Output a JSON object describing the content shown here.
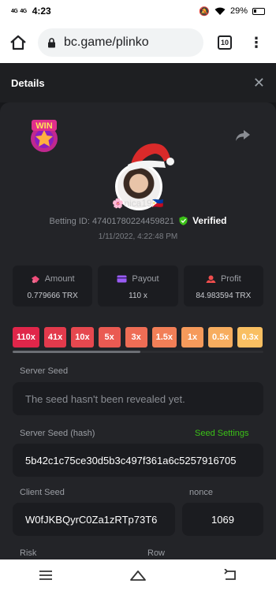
{
  "status": {
    "signal_1": "4G",
    "signal_2": "4G",
    "time": "4:23",
    "battery": "29%"
  },
  "browser": {
    "url": "bc.game/plinko",
    "tab_count": "10"
  },
  "modal": {
    "title": "Details"
  },
  "profile": {
    "badge_text": "WIN",
    "username": "🌸nica19🇵🇭",
    "betting_id_label": "Betting ID: 47401780224459821",
    "verified_label": "Verified",
    "date": "1/11/2022, 4:22:48 PM"
  },
  "stats": [
    {
      "label": "Amount",
      "value": "0.779666 TRX",
      "icon": "amount-icon"
    },
    {
      "label": "Payout",
      "value": "110 x",
      "icon": "payout-icon"
    },
    {
      "label": "Profit",
      "value": "84.983594 TRX",
      "icon": "profit-icon"
    }
  ],
  "multipliers": [
    {
      "label": "110x",
      "color": "#e0264a"
    },
    {
      "label": "41x",
      "color": "#e33a4c"
    },
    {
      "label": "10x",
      "color": "#e6484f"
    },
    {
      "label": "5x",
      "color": "#ea5a52"
    },
    {
      "label": "3x",
      "color": "#ee6d55"
    },
    {
      "label": "1.5x",
      "color": "#f27f57"
    },
    {
      "label": "1x",
      "color": "#f69a5b"
    },
    {
      "label": "0.5x",
      "color": "#f7ad5f"
    },
    {
      "label": "0.3x",
      "color": "#f9bf62"
    }
  ],
  "multiplier_scroll_fraction": 0.51,
  "fields": {
    "server_seed_label": "Server Seed",
    "server_seed_placeholder": "The seed hasn't been revealed yet.",
    "server_seed_hash_label": "Server Seed (hash)",
    "seed_settings_link": "Seed Settings",
    "server_seed_hash_value": "5b42c1c75ce30d5b3c497f361a6c5257916705",
    "client_seed_label": "Client Seed",
    "client_seed_value": "W0fJKBQyrC0Za1zRTp73T6",
    "nonce_label": "nonce",
    "nonce_value": "1069",
    "risk_label": "Risk",
    "row_label": "Row"
  },
  "colors": {
    "accent_green": "#3bc117",
    "background": "#232428",
    "field_bg": "#1b1c20"
  }
}
